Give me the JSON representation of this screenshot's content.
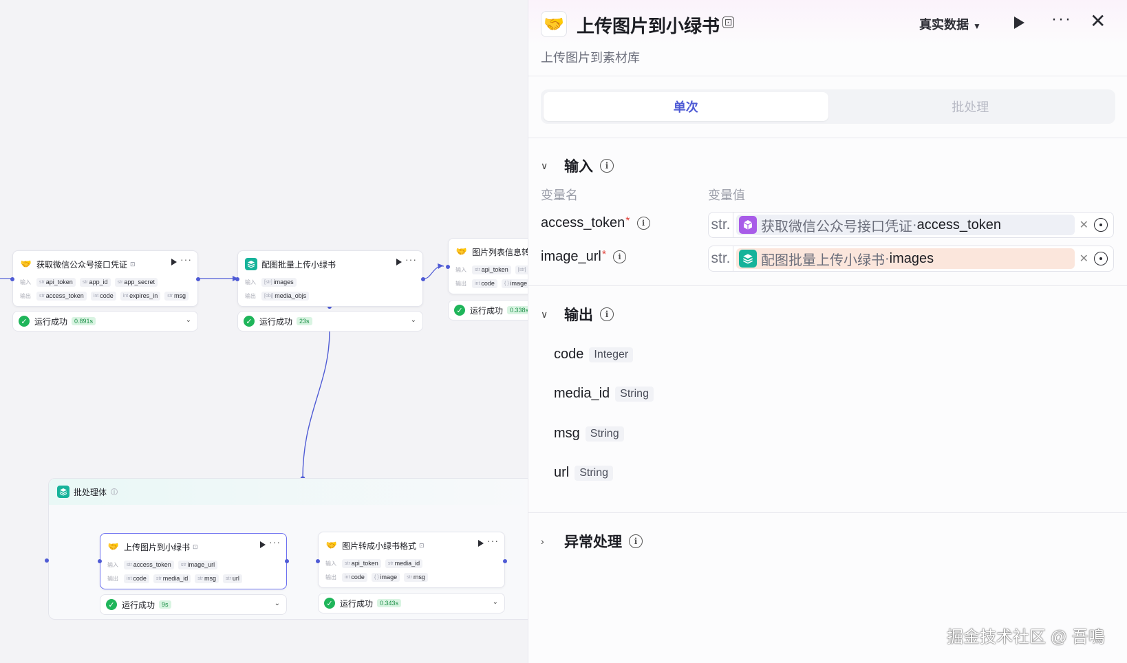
{
  "canvas": {
    "nodes": {
      "n1": {
        "title": "获取微信公众号接口凭证",
        "input_label": "输入",
        "output_label": "输出",
        "inputs": [
          {
            "t": "str",
            "n": "api_token"
          },
          {
            "t": "str",
            "n": "app_id"
          },
          {
            "t": "str",
            "n": "app_secret"
          }
        ],
        "outputs": [
          {
            "t": "str",
            "n": "access_token"
          },
          {
            "t": "int",
            "n": "code"
          },
          {
            "t": "int",
            "n": "expires_in"
          },
          {
            "t": "str",
            "n": "msg"
          }
        ],
        "status": "运行成功",
        "duration": "0.891s"
      },
      "n2": {
        "title": "配图批量上传小绿书",
        "input_label": "输入",
        "output_label": "输出",
        "inputs": [
          {
            "t": "[str]",
            "n": "images"
          }
        ],
        "outputs": [
          {
            "t": "[obj]",
            "n": "media_objs"
          }
        ],
        "status": "运行成功",
        "duration": "23s"
      },
      "n3": {
        "title": "图片列表信息转",
        "input_label": "输入",
        "output_label": "输出",
        "inputs": [
          {
            "t": "str",
            "n": "api_token"
          },
          {
            "t": "[str]",
            "n": ""
          }
        ],
        "outputs": [
          {
            "t": "int",
            "n": "code"
          },
          {
            "t": "{ }",
            "n": "image"
          }
        ],
        "status": "运行成功",
        "duration": "0.338s"
      },
      "batch": {
        "title": "批处理体"
      },
      "n4": {
        "title": "上传图片到小绿书",
        "input_label": "输入",
        "output_label": "输出",
        "inputs": [
          {
            "t": "str",
            "n": "access_token"
          },
          {
            "t": "str",
            "n": "image_url"
          }
        ],
        "outputs": [
          {
            "t": "int",
            "n": "code"
          },
          {
            "t": "str",
            "n": "media_id"
          },
          {
            "t": "str",
            "n": "msg"
          },
          {
            "t": "str",
            "n": "url"
          }
        ],
        "status": "运行成功",
        "duration": "9s"
      },
      "n5": {
        "title": "图片转成小绿书格式",
        "input_label": "输入",
        "output_label": "输出",
        "inputs": [
          {
            "t": "str",
            "n": "api_token"
          },
          {
            "t": "str",
            "n": "media_id"
          }
        ],
        "outputs": [
          {
            "t": "int",
            "n": "code"
          },
          {
            "t": "{ }",
            "n": "image"
          },
          {
            "t": "str",
            "n": "msg"
          }
        ],
        "status": "运行成功",
        "duration": "0.343s"
      }
    }
  },
  "panel": {
    "title": "上传图片到小绿书",
    "subtitle": "上传图片到素材库",
    "data_mode": "真实数据",
    "tabs": [
      "单次",
      "批处理"
    ],
    "input_section": "输入",
    "col_name": "变量名",
    "col_value": "变量值",
    "inputs": [
      {
        "name": "access_token",
        "type": "str.",
        "source_node": "获取微信公众号接口凭证",
        "sep": " · ",
        "source_field": "access_token",
        "bg": "#eef0f6",
        "icon_color": "#a85ce8"
      },
      {
        "name": "image_url",
        "type": "str.",
        "source_node": "配图批量上传小绿书",
        "sep": " · ",
        "source_field": "images",
        "bg": "#fbe6dc",
        "icon_color": "#16b39a"
      }
    ],
    "output_section": "输出",
    "outputs": [
      {
        "name": "code",
        "type": "Integer"
      },
      {
        "name": "media_id",
        "type": "String"
      },
      {
        "name": "msg",
        "type": "String"
      },
      {
        "name": "url",
        "type": "String"
      }
    ],
    "exception_section": "异常处理"
  },
  "watermark": "掘金技术社区 @ 吾鳴",
  "colors": {
    "accent": "#4f5bd5",
    "success": "#1fb55a",
    "teal": "#16b39a",
    "purple": "#a85ce8"
  }
}
